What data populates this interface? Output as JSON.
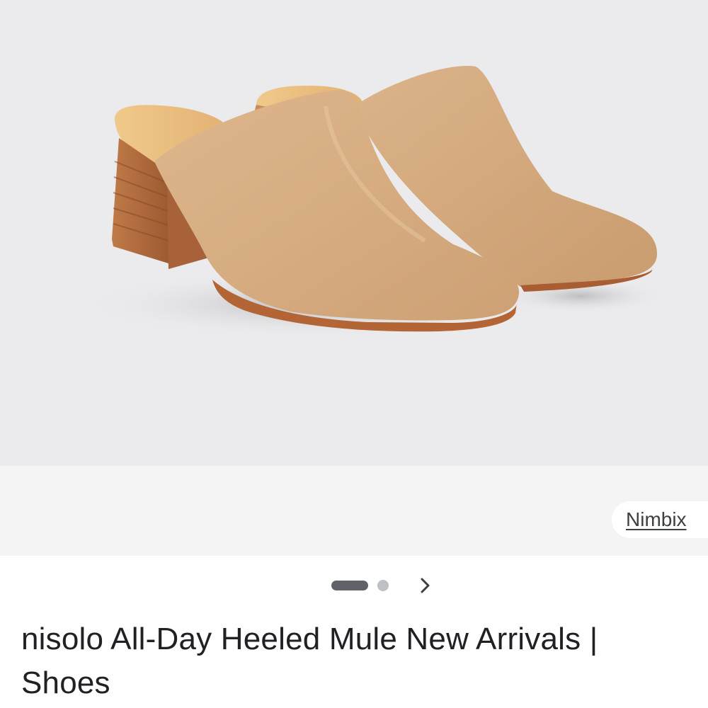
{
  "product_image": {
    "icon": "mule-shoe-image",
    "background_color": "#ebebed",
    "leather_color": "#d2a77b",
    "heel_color": "#b06a3c"
  },
  "source": {
    "label": "Nimbix"
  },
  "carousel": {
    "total_images": 2,
    "active_index": 1,
    "next_icon": "chevron-right-icon"
  },
  "result": {
    "title": "nisolo All-Day Heeled Mule New Arrivals | Shoes"
  }
}
